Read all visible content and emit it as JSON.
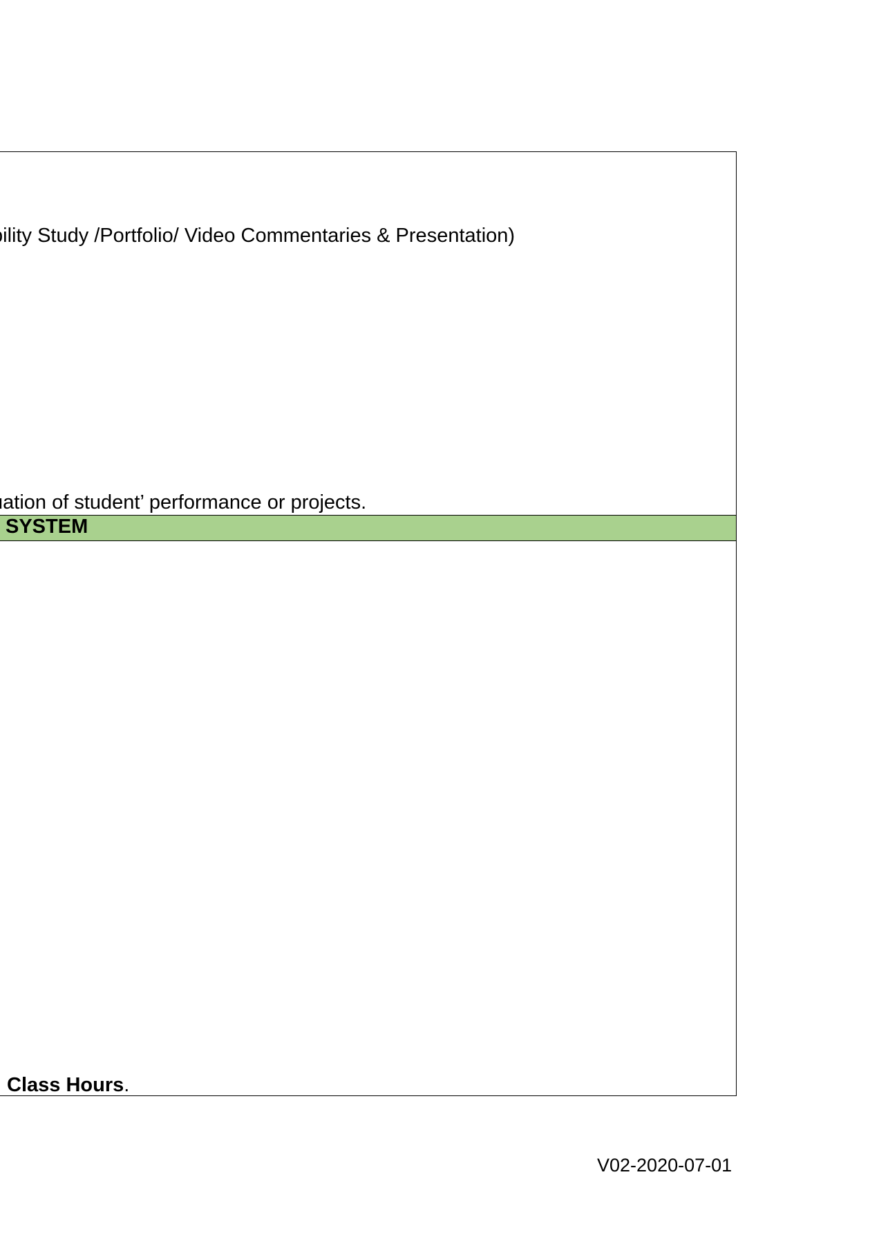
{
  "colors": {
    "section_header_bg": "#a9d18e",
    "border": "#000000",
    "text": "#000000"
  },
  "content": {
    "assessment_line": "bility Study /Portfolio/ Video Commentaries & Presentation)",
    "evaluation_line": "uation of student’ performance or projects.",
    "section_header": "SYSTEM",
    "class_hours_bold": "Class Hours",
    "class_hours_tail": "."
  },
  "footer": {
    "version": "V02-2020-07-01"
  }
}
